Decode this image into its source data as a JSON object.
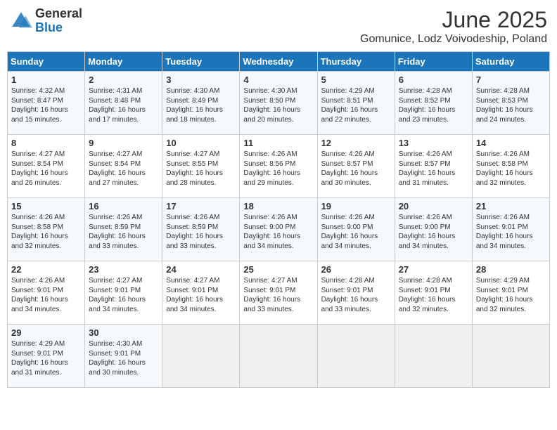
{
  "header": {
    "logo_general": "General",
    "logo_blue": "Blue",
    "month_title": "June 2025",
    "location": "Gomunice, Lodz Voivodeship, Poland"
  },
  "weekdays": [
    "Sunday",
    "Monday",
    "Tuesday",
    "Wednesday",
    "Thursday",
    "Friday",
    "Saturday"
  ],
  "weeks": [
    [
      {
        "day": "1",
        "info": "Sunrise: 4:32 AM\nSunset: 8:47 PM\nDaylight: 16 hours\nand 15 minutes."
      },
      {
        "day": "2",
        "info": "Sunrise: 4:31 AM\nSunset: 8:48 PM\nDaylight: 16 hours\nand 17 minutes."
      },
      {
        "day": "3",
        "info": "Sunrise: 4:30 AM\nSunset: 8:49 PM\nDaylight: 16 hours\nand 18 minutes."
      },
      {
        "day": "4",
        "info": "Sunrise: 4:30 AM\nSunset: 8:50 PM\nDaylight: 16 hours\nand 20 minutes."
      },
      {
        "day": "5",
        "info": "Sunrise: 4:29 AM\nSunset: 8:51 PM\nDaylight: 16 hours\nand 22 minutes."
      },
      {
        "day": "6",
        "info": "Sunrise: 4:28 AM\nSunset: 8:52 PM\nDaylight: 16 hours\nand 23 minutes."
      },
      {
        "day": "7",
        "info": "Sunrise: 4:28 AM\nSunset: 8:53 PM\nDaylight: 16 hours\nand 24 minutes."
      }
    ],
    [
      {
        "day": "8",
        "info": "Sunrise: 4:27 AM\nSunset: 8:54 PM\nDaylight: 16 hours\nand 26 minutes."
      },
      {
        "day": "9",
        "info": "Sunrise: 4:27 AM\nSunset: 8:54 PM\nDaylight: 16 hours\nand 27 minutes."
      },
      {
        "day": "10",
        "info": "Sunrise: 4:27 AM\nSunset: 8:55 PM\nDaylight: 16 hours\nand 28 minutes."
      },
      {
        "day": "11",
        "info": "Sunrise: 4:26 AM\nSunset: 8:56 PM\nDaylight: 16 hours\nand 29 minutes."
      },
      {
        "day": "12",
        "info": "Sunrise: 4:26 AM\nSunset: 8:57 PM\nDaylight: 16 hours\nand 30 minutes."
      },
      {
        "day": "13",
        "info": "Sunrise: 4:26 AM\nSunset: 8:57 PM\nDaylight: 16 hours\nand 31 minutes."
      },
      {
        "day": "14",
        "info": "Sunrise: 4:26 AM\nSunset: 8:58 PM\nDaylight: 16 hours\nand 32 minutes."
      }
    ],
    [
      {
        "day": "15",
        "info": "Sunrise: 4:26 AM\nSunset: 8:58 PM\nDaylight: 16 hours\nand 32 minutes."
      },
      {
        "day": "16",
        "info": "Sunrise: 4:26 AM\nSunset: 8:59 PM\nDaylight: 16 hours\nand 33 minutes."
      },
      {
        "day": "17",
        "info": "Sunrise: 4:26 AM\nSunset: 8:59 PM\nDaylight: 16 hours\nand 33 minutes."
      },
      {
        "day": "18",
        "info": "Sunrise: 4:26 AM\nSunset: 9:00 PM\nDaylight: 16 hours\nand 34 minutes."
      },
      {
        "day": "19",
        "info": "Sunrise: 4:26 AM\nSunset: 9:00 PM\nDaylight: 16 hours\nand 34 minutes."
      },
      {
        "day": "20",
        "info": "Sunrise: 4:26 AM\nSunset: 9:00 PM\nDaylight: 16 hours\nand 34 minutes."
      },
      {
        "day": "21",
        "info": "Sunrise: 4:26 AM\nSunset: 9:01 PM\nDaylight: 16 hours\nand 34 minutes."
      }
    ],
    [
      {
        "day": "22",
        "info": "Sunrise: 4:26 AM\nSunset: 9:01 PM\nDaylight: 16 hours\nand 34 minutes."
      },
      {
        "day": "23",
        "info": "Sunrise: 4:27 AM\nSunset: 9:01 PM\nDaylight: 16 hours\nand 34 minutes."
      },
      {
        "day": "24",
        "info": "Sunrise: 4:27 AM\nSunset: 9:01 PM\nDaylight: 16 hours\nand 34 minutes."
      },
      {
        "day": "25",
        "info": "Sunrise: 4:27 AM\nSunset: 9:01 PM\nDaylight: 16 hours\nand 33 minutes."
      },
      {
        "day": "26",
        "info": "Sunrise: 4:28 AM\nSunset: 9:01 PM\nDaylight: 16 hours\nand 33 minutes."
      },
      {
        "day": "27",
        "info": "Sunrise: 4:28 AM\nSunset: 9:01 PM\nDaylight: 16 hours\nand 32 minutes."
      },
      {
        "day": "28",
        "info": "Sunrise: 4:29 AM\nSunset: 9:01 PM\nDaylight: 16 hours\nand 32 minutes."
      }
    ],
    [
      {
        "day": "29",
        "info": "Sunrise: 4:29 AM\nSunset: 9:01 PM\nDaylight: 16 hours\nand 31 minutes."
      },
      {
        "day": "30",
        "info": "Sunrise: 4:30 AM\nSunset: 9:01 PM\nDaylight: 16 hours\nand 30 minutes."
      },
      {
        "day": "",
        "info": ""
      },
      {
        "day": "",
        "info": ""
      },
      {
        "day": "",
        "info": ""
      },
      {
        "day": "",
        "info": ""
      },
      {
        "day": "",
        "info": ""
      }
    ]
  ]
}
